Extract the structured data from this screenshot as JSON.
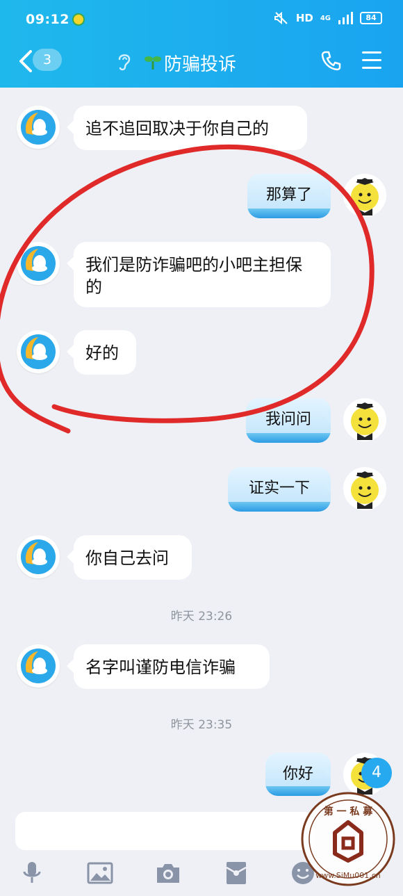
{
  "status_bar": {
    "time": "09:12",
    "network": "HD",
    "signal": "4G",
    "battery": "84"
  },
  "nav": {
    "back_count": "3",
    "title": "防骗投诉"
  },
  "messages": [
    {
      "side": "left",
      "text": "追不追回取决于你自己的"
    },
    {
      "side": "right",
      "text": "那算了"
    },
    {
      "side": "left",
      "text": "我们是防诈骗吧的小吧主担保的"
    },
    {
      "side": "left",
      "text": "好的"
    },
    {
      "side": "right",
      "text": "我问问"
    },
    {
      "side": "right",
      "text": "证实一下"
    },
    {
      "side": "left",
      "text": "你自己去问"
    },
    {
      "side": "timestamp",
      "text": "昨天 23:26"
    },
    {
      "side": "left",
      "text": "名字叫谨防电信诈骗"
    },
    {
      "side": "timestamp",
      "text": "昨天 23:35"
    },
    {
      "side": "right",
      "text": "你好"
    }
  ],
  "unread_badge": "4",
  "toolbar": [
    "microphone-icon",
    "image-icon",
    "camera-icon",
    "red-packet-icon",
    "emoji-icon"
  ],
  "watermark": {
    "top": "第 一 私 募",
    "bottom": "www.SiMu001.cn"
  },
  "colors": {
    "header": "#1aa4f0",
    "background": "#eef0f5",
    "annotation": "#e02a2a"
  }
}
